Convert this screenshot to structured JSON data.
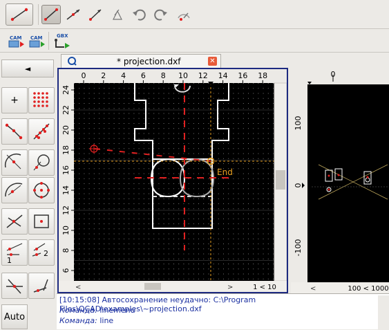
{
  "toolbar": {
    "tools_row1": [
      "line-tool",
      "line-2points-tool",
      "line-angle-tool",
      "line-bisector-tool",
      "undo-tool",
      "redo-tool",
      "gauge-tool"
    ],
    "tools_row2": [
      {
        "label": "CAM",
        "name": "cam-export-button"
      },
      {
        "label": "CAM",
        "name": "cam-import-button"
      },
      {
        "label": "GBX",
        "name": "gbx-export-button"
      }
    ]
  },
  "tab": {
    "title": "* projection.dxf"
  },
  "main_view": {
    "ruler_top": [
      "0",
      "2",
      "4",
      "6",
      "8",
      "10",
      "12",
      "14",
      "16",
      "18"
    ],
    "ruler_left": [
      "24",
      "22",
      "20",
      "18",
      "16",
      "14",
      "12",
      "10",
      "8",
      "6"
    ],
    "snap_label": "End",
    "status_scale": "1 < 10"
  },
  "side_view": {
    "ruler_top": [
      "0"
    ],
    "ruler_left": [
      "100",
      "0",
      "-100"
    ],
    "status_scale": "100 < 1000"
  },
  "left_panel": {
    "back_symbol": "◄",
    "auto_label": "Auto",
    "plus_symbol": "+",
    "number_1": "1",
    "number_2": "2"
  },
  "command": {
    "lines": [
      {
        "time": "[10:15:08]",
        "text": "Автосохранение неудачно: C:\\Program Files\\QCAD\\examples\\~projection.dxf"
      },
      {
        "label": "Команда:",
        "value": "linemenu"
      },
      {
        "label": "Команда:",
        "value": "line"
      }
    ]
  },
  "colors": {
    "accent_red": "#e02020",
    "frame_blue": "#1d2a80",
    "snap_orange": "#e8a020"
  }
}
